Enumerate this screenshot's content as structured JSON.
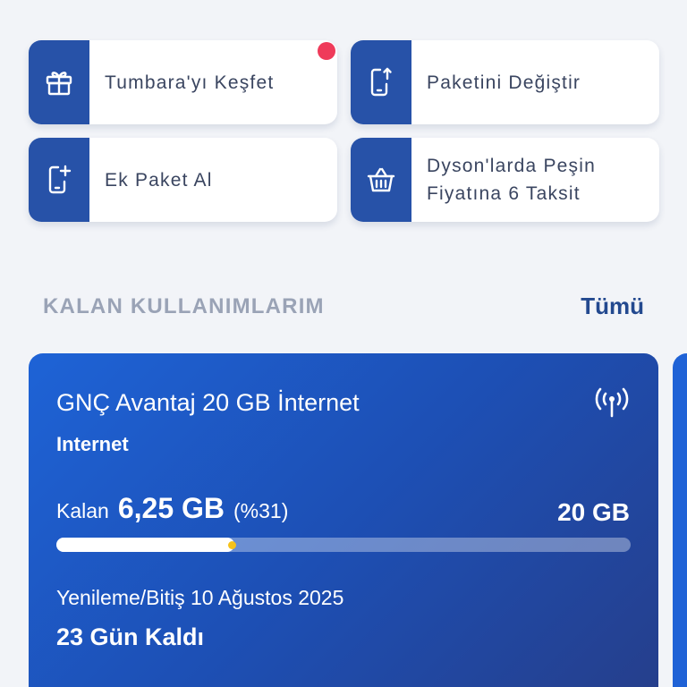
{
  "quick_actions": [
    {
      "label": "Tumbara'yı Keşfet",
      "icon": "gift-icon",
      "has_notification": true
    },
    {
      "label": "Paketini Değiştir",
      "icon": "phone-upgrade-icon",
      "has_notification": false
    },
    {
      "label": "Ek Paket Al",
      "icon": "phone-add-icon",
      "has_notification": false
    },
    {
      "label": "Dyson'larda Peşin Fiyatına 6 Taksit",
      "icon": "basket-icon",
      "has_notification": false
    }
  ],
  "section": {
    "title": "KALAN KULLANIMLARIM",
    "see_all_label": "Tümü"
  },
  "usage_card": {
    "plan_name": "GNÇ Avantaj 20 GB İnternet",
    "plan_type": "Internet",
    "remaining_label": "Kalan",
    "remaining_value": "6,25 GB",
    "remaining_percent_text": "(%31)",
    "total_value": "20 GB",
    "progress_fraction": 0.31,
    "renewal_text": "Yenileme/Bitiş 10 Ağustos 2025",
    "days_left_text": "23 Gün Kaldı",
    "icon": "signal-antenna-icon"
  },
  "colors": {
    "accent": "#2752a8",
    "card_gradient_start": "#1e63d6",
    "card_gradient_end": "#263e8a",
    "notification": "#ef3b5a",
    "progress_knob": "#f6c21a"
  }
}
